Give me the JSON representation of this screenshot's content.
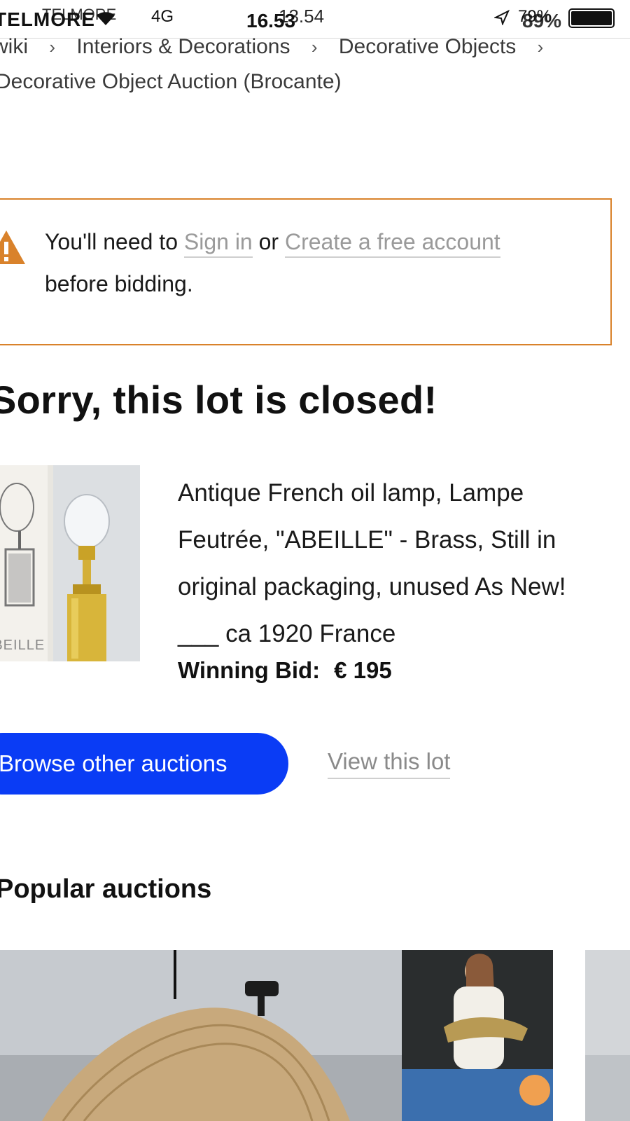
{
  "status_bar": {
    "carrier_a": "TELMORE",
    "carrier_b": "TELMORE",
    "network": "4G",
    "time_a": "16.53",
    "time_b": "13.54",
    "battery_a": "79%",
    "battery_b": "89%"
  },
  "breadcrumb": {
    "items": [
      "wiki",
      "Interiors & Decorations",
      "Decorative Objects"
    ],
    "current": "Decorative Object Auction (Brocante)"
  },
  "alert": {
    "prefix": "You'll need to",
    "sign_in": "Sign in",
    "or": "or",
    "create_account": "Create a free account",
    "suffix": "before bidding."
  },
  "lot": {
    "closed_title": "Sorry, this lot is closed!",
    "description": "Antique French oil lamp, Lampe Feutrée, \"ABEILLE\" - Brass, Still in original packaging, unused As New! ___ ca 1920 France",
    "box_label": "ABEILLE",
    "winning_bid_label": "Winning Bid:",
    "winning_bid_value": "€ 195"
  },
  "actions": {
    "browse": "Browse other auctions",
    "view_lot": "View this lot"
  },
  "popular": {
    "title": "Popular auctions"
  },
  "colors": {
    "accent_blue": "#0a3cf5",
    "warning_orange": "#d9822b",
    "link_grey": "#9a9a9a"
  }
}
